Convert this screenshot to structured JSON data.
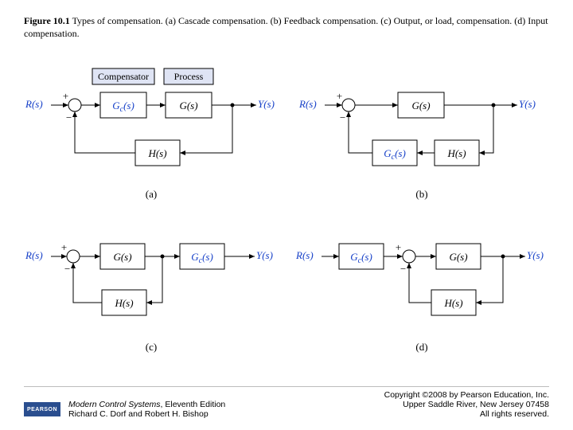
{
  "caption": {
    "fignum": "Figure 10.1",
    "rest": "   Types of compensation. (a) Cascade compensation. (b) Feedback compensation. (c) Output, or load, compensation. (d) Input compensation."
  },
  "sublabels": {
    "a": "(a)",
    "b": "(b)",
    "c": "(c)",
    "d": "(d)"
  },
  "signals": {
    "R": "R(s)",
    "Y": "Y(s)",
    "plus": "+",
    "minus": "−"
  },
  "blocks": {
    "Gc": "Gc(s)",
    "G": "G(s)",
    "H": "H(s)",
    "Gcsub": "G",
    "csub": "(s)"
  },
  "headers": {
    "comp": "Compensator",
    "proc": "Process"
  },
  "footer": {
    "pearson": "PEARSON",
    "book": "Modern Control Systems",
    "edition": ", Eleventh Edition",
    "authors": "Richard C. Dorf and Robert H. Bishop",
    "copy": "Copyright ©2008 by Pearson Education, Inc.",
    "addr": "Upper Saddle River, New Jersey 07458",
    "rights": "All rights reserved."
  },
  "chart_data": [
    {
      "id": "a",
      "type": "block-diagram",
      "title": "Cascade compensation",
      "nodes": [
        {
          "id": "R",
          "kind": "input",
          "label": "R(s)"
        },
        {
          "id": "S1",
          "kind": "sum",
          "signs": [
            "+",
            "-"
          ]
        },
        {
          "id": "Gc",
          "kind": "block",
          "label": "Gc(s)",
          "note": "Compensator"
        },
        {
          "id": "G",
          "kind": "block",
          "label": "G(s)",
          "note": "Process"
        },
        {
          "id": "Y",
          "kind": "output",
          "label": "Y(s)"
        },
        {
          "id": "H",
          "kind": "block",
          "label": "H(s)"
        }
      ],
      "edges": [
        [
          "R",
          "S1"
        ],
        [
          "S1",
          "Gc"
        ],
        [
          "Gc",
          "G"
        ],
        [
          "G",
          "Y"
        ],
        [
          "Y",
          "H"
        ],
        [
          "H",
          "S1"
        ]
      ]
    },
    {
      "id": "b",
      "type": "block-diagram",
      "title": "Feedback compensation",
      "nodes": [
        {
          "id": "R",
          "kind": "input",
          "label": "R(s)"
        },
        {
          "id": "S1",
          "kind": "sum",
          "signs": [
            "+",
            "-"
          ]
        },
        {
          "id": "G",
          "kind": "block",
          "label": "G(s)"
        },
        {
          "id": "Y",
          "kind": "output",
          "label": "Y(s)"
        },
        {
          "id": "Gc",
          "kind": "block",
          "label": "Gc(s)"
        },
        {
          "id": "H",
          "kind": "block",
          "label": "H(s)"
        }
      ],
      "edges": [
        [
          "R",
          "S1"
        ],
        [
          "S1",
          "G"
        ],
        [
          "G",
          "Y"
        ],
        [
          "Y",
          "H"
        ],
        [
          "H",
          "Gc"
        ],
        [
          "Gc",
          "S1"
        ]
      ]
    },
    {
      "id": "c",
      "type": "block-diagram",
      "title": "Output (load) compensation",
      "nodes": [
        {
          "id": "R",
          "kind": "input",
          "label": "R(s)"
        },
        {
          "id": "S1",
          "kind": "sum",
          "signs": [
            "+",
            "-"
          ]
        },
        {
          "id": "G",
          "kind": "block",
          "label": "G(s)"
        },
        {
          "id": "Gc",
          "kind": "block",
          "label": "Gc(s)"
        },
        {
          "id": "Y",
          "kind": "output",
          "label": "Y(s)"
        },
        {
          "id": "H",
          "kind": "block",
          "label": "H(s)"
        }
      ],
      "edges": [
        [
          "R",
          "S1"
        ],
        [
          "S1",
          "G"
        ],
        [
          "G",
          "Gc"
        ],
        [
          "Gc",
          "Y"
        ],
        [
          "Y_pre_Gc",
          "H"
        ],
        [
          "H",
          "S1"
        ]
      ]
    },
    {
      "id": "d",
      "type": "block-diagram",
      "title": "Input compensation",
      "nodes": [
        {
          "id": "R",
          "kind": "input",
          "label": "R(s)"
        },
        {
          "id": "Gc",
          "kind": "block",
          "label": "Gc(s)"
        },
        {
          "id": "S1",
          "kind": "sum",
          "signs": [
            "+",
            "-"
          ]
        },
        {
          "id": "G",
          "kind": "block",
          "label": "G(s)"
        },
        {
          "id": "Y",
          "kind": "output",
          "label": "Y(s)"
        },
        {
          "id": "H",
          "kind": "block",
          "label": "H(s)"
        }
      ],
      "edges": [
        [
          "R",
          "Gc"
        ],
        [
          "Gc",
          "S1"
        ],
        [
          "S1",
          "G"
        ],
        [
          "G",
          "Y"
        ],
        [
          "Y",
          "H"
        ],
        [
          "H",
          "S1"
        ]
      ]
    }
  ]
}
